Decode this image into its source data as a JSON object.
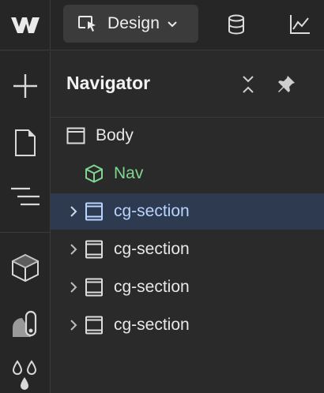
{
  "topbar": {
    "logo_icon": "webflow-logo-icon",
    "mode": {
      "label": "Design",
      "icon": "cursor-select-icon"
    },
    "right_icons": [
      "database-icon",
      "analytics-chart-icon"
    ]
  },
  "rail": {
    "items": [
      "add-icon",
      "page-icon",
      "navigator-icon",
      "components-icon",
      "style-manager-icon",
      "color-swatch-icon"
    ]
  },
  "navigator": {
    "title": "Navigator",
    "actions": [
      "collapse-all-icon",
      "pin-icon"
    ],
    "tree": [
      {
        "label": "Body",
        "icon": "body-box-icon",
        "expandable": false,
        "selected": false,
        "indent": 0
      },
      {
        "label": "Nav",
        "icon": "component-cube-icon",
        "expandable": false,
        "selected": false,
        "indent": 1,
        "color": "#7ed68f"
      },
      {
        "label": "cg-section",
        "icon": "section-icon",
        "expandable": true,
        "selected": true,
        "indent": 1
      },
      {
        "label": "cg-section",
        "icon": "section-icon",
        "expandable": true,
        "selected": false,
        "indent": 1
      },
      {
        "label": "cg-section",
        "icon": "section-icon",
        "expandable": true,
        "selected": false,
        "indent": 1
      },
      {
        "label": "cg-section",
        "icon": "section-icon",
        "expandable": true,
        "selected": false,
        "indent": 1
      }
    ]
  },
  "colors": {
    "background": "#2a2a2a",
    "selection": "#2d3a4f",
    "selected_text": "#b9d3ff",
    "component_green": "#7ed68f"
  }
}
